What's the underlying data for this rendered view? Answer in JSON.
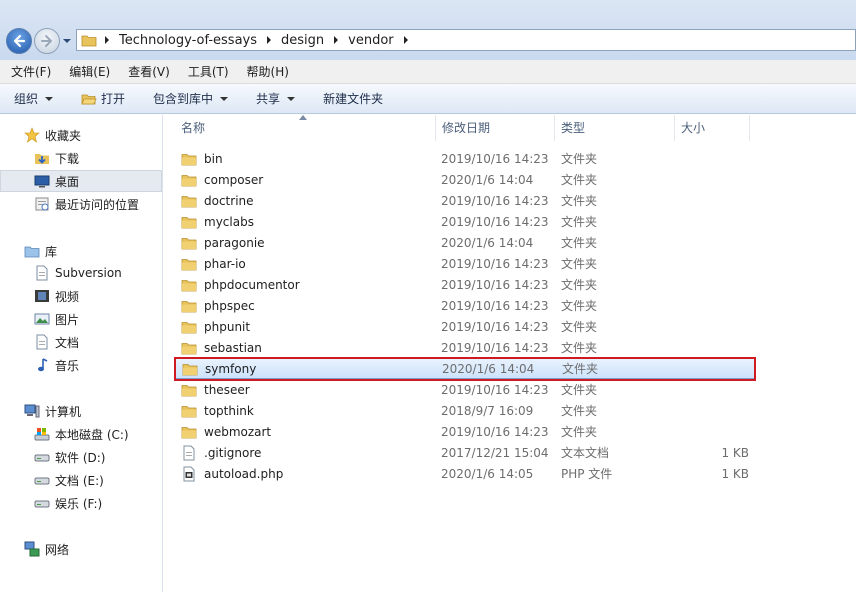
{
  "address": {
    "breadcrumbs": [
      "Technology-of-essays",
      "design",
      "vendor"
    ]
  },
  "menu": [
    "文件(F)",
    "编辑(E)",
    "查看(V)",
    "工具(T)",
    "帮助(H)"
  ],
  "toolbar": {
    "organize": "组织",
    "open": "打开",
    "include_library": "包含到库中",
    "share": "共享",
    "new_folder": "新建文件夹"
  },
  "nav": {
    "favorites": "收藏夹",
    "downloads": "下载",
    "desktop": "桌面",
    "recent": "最近访问的位置",
    "libraries": "库",
    "subversion": "Subversion",
    "videos": "视频",
    "pictures": "图片",
    "documents": "文档",
    "music": "音乐",
    "computer": "计算机",
    "drive_c": "本地磁盘 (C:)",
    "drive_d": "软件 (D:)",
    "drive_e": "文档 (E:)",
    "drive_f": "娱乐 (F:)",
    "network": "网络"
  },
  "columns": {
    "name": "名称",
    "date": "修改日期",
    "type": "类型",
    "size": "大小"
  },
  "files": [
    {
      "name": "bin",
      "date": "2019/10/16 14:23",
      "type": "文件夹",
      "size": "",
      "kind": "folder"
    },
    {
      "name": "composer",
      "date": "2020/1/6 14:04",
      "type": "文件夹",
      "size": "",
      "kind": "folder"
    },
    {
      "name": "doctrine",
      "date": "2019/10/16 14:23",
      "type": "文件夹",
      "size": "",
      "kind": "folder"
    },
    {
      "name": "myclabs",
      "date": "2019/10/16 14:23",
      "type": "文件夹",
      "size": "",
      "kind": "folder"
    },
    {
      "name": "paragonie",
      "date": "2020/1/6 14:04",
      "type": "文件夹",
      "size": "",
      "kind": "folder"
    },
    {
      "name": "phar-io",
      "date": "2019/10/16 14:23",
      "type": "文件夹",
      "size": "",
      "kind": "folder"
    },
    {
      "name": "phpdocumentor",
      "date": "2019/10/16 14:23",
      "type": "文件夹",
      "size": "",
      "kind": "folder"
    },
    {
      "name": "phpspec",
      "date": "2019/10/16 14:23",
      "type": "文件夹",
      "size": "",
      "kind": "folder"
    },
    {
      "name": "phpunit",
      "date": "2019/10/16 14:23",
      "type": "文件夹",
      "size": "",
      "kind": "folder"
    },
    {
      "name": "sebastian",
      "date": "2019/10/16 14:23",
      "type": "文件夹",
      "size": "",
      "kind": "folder"
    },
    {
      "name": "symfony",
      "date": "2020/1/6 14:04",
      "type": "文件夹",
      "size": "",
      "kind": "folder"
    },
    {
      "name": "theseer",
      "date": "2019/10/16 14:23",
      "type": "文件夹",
      "size": "",
      "kind": "folder"
    },
    {
      "name": "topthink",
      "date": "2018/9/7 16:09",
      "type": "文件夹",
      "size": "",
      "kind": "folder"
    },
    {
      "name": "webmozart",
      "date": "2019/10/16 14:23",
      "type": "文件夹",
      "size": "",
      "kind": "folder"
    },
    {
      "name": ".gitignore",
      "date": "2017/12/21 15:04",
      "type": "文本文档",
      "size": "1 KB",
      "kind": "text"
    },
    {
      "name": "autoload.php",
      "date": "2020/1/6 14:05",
      "type": "PHP 文件",
      "size": "1 KB",
      "kind": "php"
    }
  ],
  "selected_file": "symfony",
  "colors": {
    "highlight_border": "#d01a22",
    "selection_fill": "#cde3fb",
    "folder": "#e8c25a"
  }
}
